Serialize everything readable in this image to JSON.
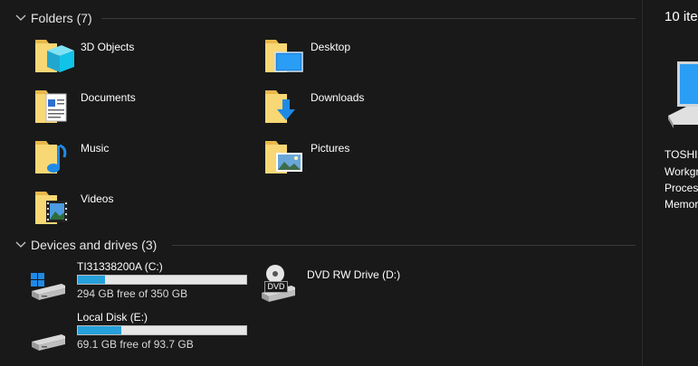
{
  "groups": {
    "folders": {
      "title": "Folders (7)"
    },
    "devices": {
      "title": "Devices and drives (3)"
    }
  },
  "folders": [
    {
      "label": "3D Objects",
      "icon": "folder-3d-objects-icon"
    },
    {
      "label": "Desktop",
      "icon": "folder-desktop-icon"
    },
    {
      "label": "Documents",
      "icon": "folder-documents-icon"
    },
    {
      "label": "Downloads",
      "icon": "folder-downloads-icon"
    },
    {
      "label": "Music",
      "icon": "folder-music-icon"
    },
    {
      "label": "Pictures",
      "icon": "folder-pictures-icon"
    },
    {
      "label": "Videos",
      "icon": "folder-videos-icon"
    }
  ],
  "drives": [
    {
      "name": "TI31338200A (C:)",
      "free": "294 GB free of 350 GB",
      "used_fraction": 0.16,
      "icon": "windows-drive-icon"
    },
    {
      "name": "DVD RW Drive (D:)",
      "icon": "dvd-drive-icon",
      "dvd_label": "DVD"
    },
    {
      "name": "Local Disk (E:)",
      "free": "69.1 GB free of 93.7 GB",
      "used_fraction": 0.26,
      "icon": "hard-disk-icon"
    }
  ],
  "details": {
    "count": "10 ite",
    "lines": [
      "TOSHI",
      "Workgr",
      "Process",
      "Memor"
    ]
  },
  "colors": {
    "background": "#191919",
    "bar_fill": "#26a0da",
    "folder_yellow": "#f8d775"
  }
}
